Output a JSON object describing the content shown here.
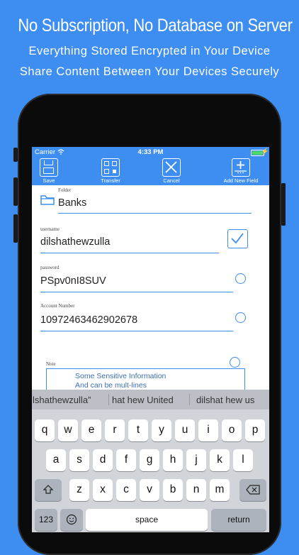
{
  "promo": {
    "headline": "No Subscription, No Database on Server",
    "line2": "Everything Stored Encrypted in Your Device",
    "line3": "Share Content Between Your Devices Securely"
  },
  "status_bar": {
    "carrier": "Carrier",
    "time": "4:33 PM"
  },
  "toolbar": {
    "save": "Save",
    "transfer": "Transfer",
    "cancel": "Cancel",
    "add_field": "Add New Field"
  },
  "form": {
    "folder": {
      "label": "Folder",
      "value": "Banks"
    },
    "username": {
      "label": "username",
      "value": "dilshathewzulla",
      "checked": true
    },
    "password": {
      "label": "password",
      "value": "PSpv0nI8SUV"
    },
    "account": {
      "label": "Account Number",
      "value": "10972463462902678"
    },
    "note": {
      "label": "Note",
      "line1": "Some Sensitive Information",
      "line2": "And can be mult-lines"
    }
  },
  "keyboard": {
    "suggestions": [
      "lshathewzulla”",
      "hat hew United",
      "dilshat hew us"
    ],
    "row1": [
      "q",
      "w",
      "e",
      "r",
      "t",
      "y",
      "u",
      "i",
      "o",
      "p"
    ],
    "row2": [
      "a",
      "s",
      "d",
      "f",
      "g",
      "h",
      "j",
      "k",
      "l"
    ],
    "row3": [
      "z",
      "x",
      "c",
      "v",
      "b",
      "n",
      "m"
    ],
    "numbers_key": "123",
    "space_key": "space",
    "return_key": "return",
    "shift_icon": "shift-icon",
    "delete_icon": "backspace-icon",
    "emoji_icon": "emoji-icon"
  },
  "colors": {
    "accent": "#3d8ef0",
    "keyboard_bg": "#d1d4d9"
  }
}
